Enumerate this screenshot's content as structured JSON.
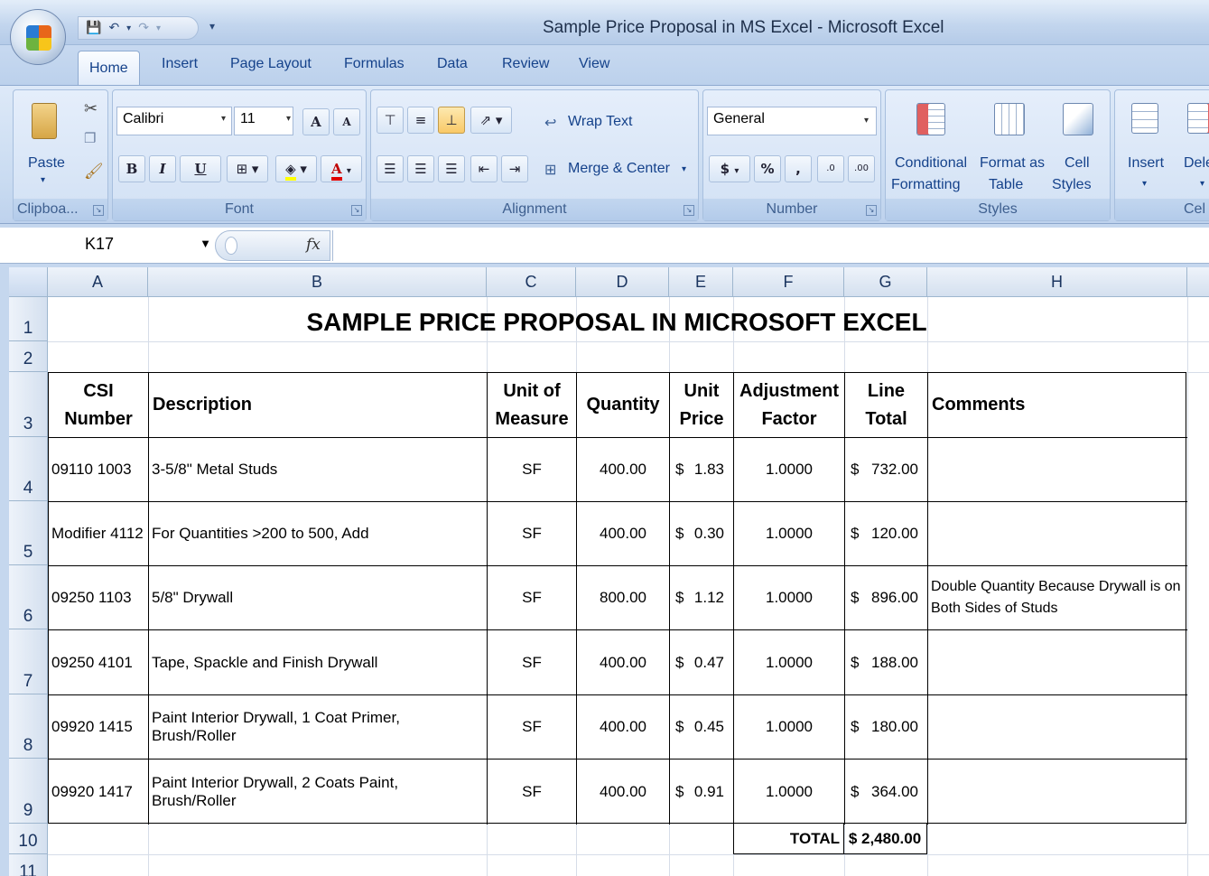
{
  "window": {
    "title": "Sample Price Proposal in MS Excel - Microsoft Excel"
  },
  "tabs": [
    "Home",
    "Insert",
    "Page Layout",
    "Formulas",
    "Data",
    "Review",
    "View"
  ],
  "active_tab": "Home",
  "ribbon": {
    "clipboard": {
      "paste_label": "Paste",
      "group_label": "Clipboa..."
    },
    "font": {
      "name": "Calibri",
      "size": "11",
      "bold": "B",
      "italic": "I",
      "underline": "U",
      "grow": "A",
      "shrink": "A",
      "font_color_letter": "A",
      "group_label": "Font"
    },
    "alignment": {
      "wrap_text": "Wrap Text",
      "merge_center": "Merge & Center",
      "group_label": "Alignment"
    },
    "number": {
      "format": "General",
      "currency": "$",
      "percent": "%",
      "comma": ",",
      "inc_decimal": ".0",
      "dec_decimal": ".00",
      "group_label": "Number"
    },
    "styles": {
      "conditional": "Conditional",
      "conditional2": "Formatting",
      "format_as": "Format as",
      "format_as2": "Table",
      "cell": "Cell",
      "cell2": "Styles",
      "group_label": "Styles"
    },
    "cells": {
      "insert": "Insert",
      "delete": "Dele",
      "group_label": "Cel"
    }
  },
  "formula_bar": {
    "name_box": "K17",
    "fx": "fx",
    "content": ""
  },
  "columns": [
    "A",
    "B",
    "C",
    "D",
    "E",
    "F",
    "G",
    "H"
  ],
  "rows": [
    "1",
    "2",
    "3",
    "4",
    "5",
    "6",
    "7",
    "8",
    "9",
    "10",
    "11"
  ],
  "sheet": {
    "title": "SAMPLE PRICE PROPOSAL IN MICROSOFT EXCEL",
    "headers": {
      "csi": [
        "CSI",
        "Number"
      ],
      "description": "Description",
      "unit": [
        "Unit of",
        "Measure"
      ],
      "quantity": "Quantity",
      "unit_price": [
        "Unit",
        "Price"
      ],
      "adjustment": [
        "Adjustment",
        "Factor"
      ],
      "line_total": [
        "Line",
        "Total"
      ],
      "comments": "Comments"
    },
    "items": [
      {
        "csi": "09110 1003",
        "description": "3-5/8\" Metal Studs",
        "unit": "SF",
        "quantity": "400.00",
        "price": "1.83",
        "factor": "1.0000",
        "total": "732.00",
        "comment": ""
      },
      {
        "csi": "Modifier 4112",
        "description": "For Quantities >200 to 500, Add",
        "unit": "SF",
        "quantity": "400.00",
        "price": "0.30",
        "factor": "1.0000",
        "total": "120.00",
        "comment": ""
      },
      {
        "csi": "09250 1103",
        "description": "5/8\" Drywall",
        "unit": "SF",
        "quantity": "800.00",
        "price": "1.12",
        "factor": "1.0000",
        "total": "896.00",
        "comment": "Double Quantity Because Drywall is on Both Sides of Studs"
      },
      {
        "csi": "09250 4101",
        "description": "Tape, Spackle and Finish Drywall",
        "unit": "SF",
        "quantity": "400.00",
        "price": "0.47",
        "factor": "1.0000",
        "total": "188.00",
        "comment": ""
      },
      {
        "csi": "09920 1415",
        "description": "Paint Interior Drywall, 1 Coat Primer, Brush/Roller",
        "unit": "SF",
        "quantity": "400.00",
        "price": "0.45",
        "factor": "1.0000",
        "total": "180.00",
        "comment": ""
      },
      {
        "csi": "09920 1417",
        "description": "Paint Interior Drywall, 2 Coats Paint, Brush/Roller",
        "unit": "SF",
        "quantity": "400.00",
        "price": "0.91",
        "factor": "1.0000",
        "total": "364.00",
        "comment": ""
      }
    ],
    "currency_symbol": "$",
    "total_label": "TOTAL",
    "total_value": "$ 2,480.00"
  }
}
